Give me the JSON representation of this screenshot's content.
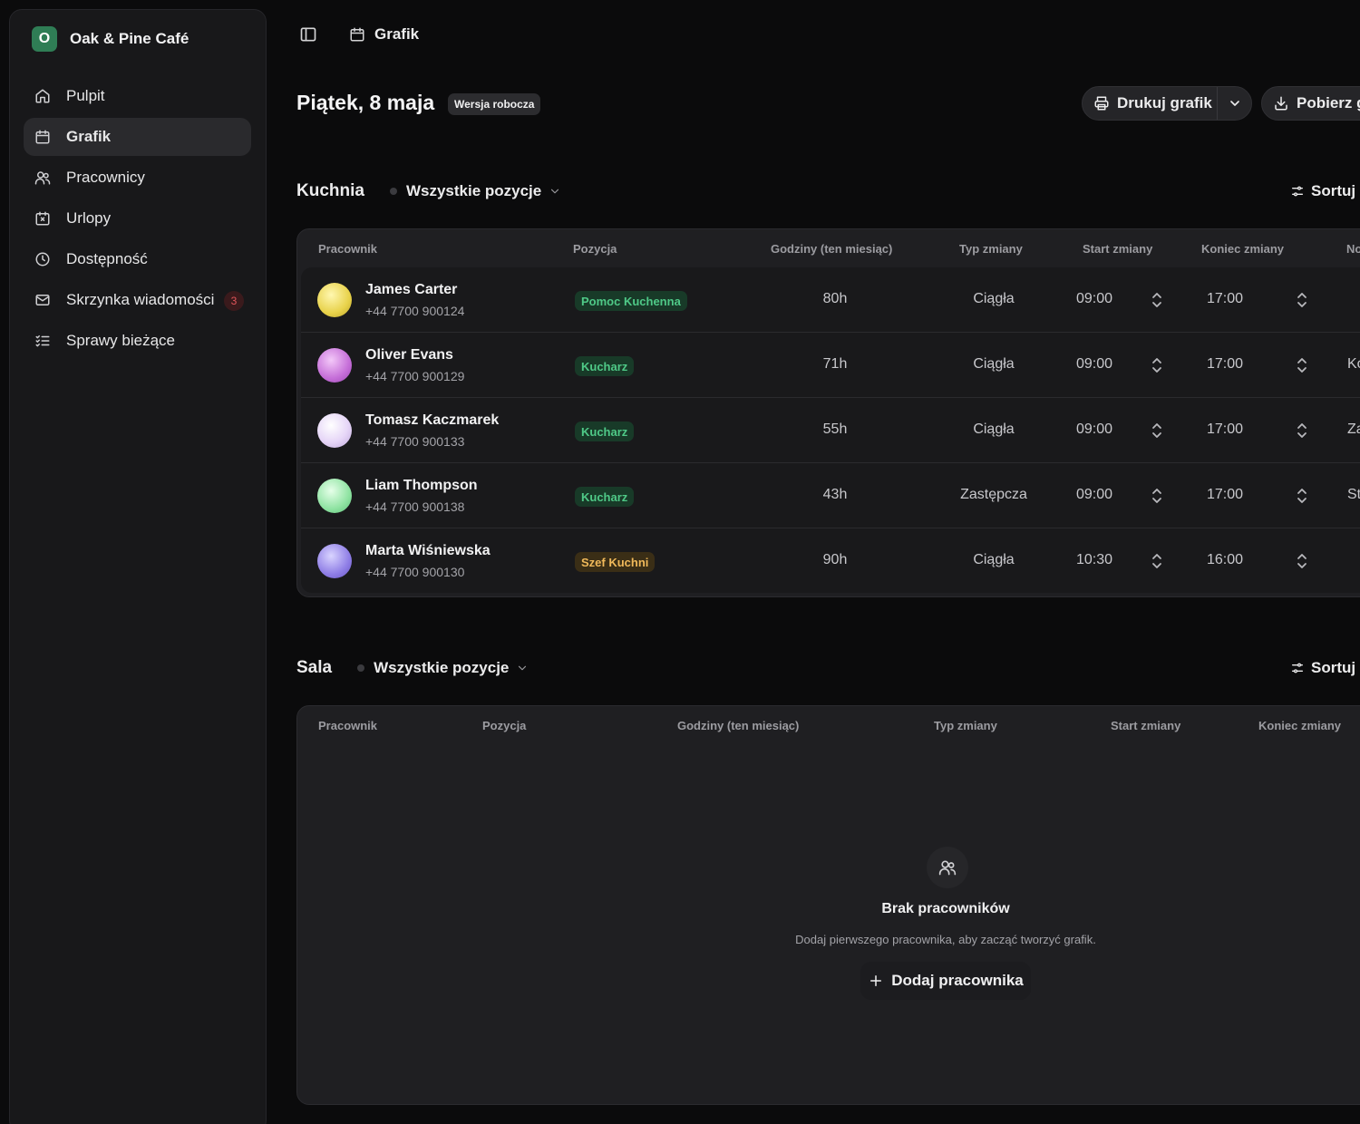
{
  "sidebar": {
    "brand_initial": "O",
    "brand_name": "Oak & Pine Café",
    "items": [
      {
        "label": "Pulpit",
        "icon": "home-icon"
      },
      {
        "label": "Grafik",
        "icon": "calendar-icon",
        "active": true
      },
      {
        "label": "Pracownicy",
        "icon": "users-icon"
      },
      {
        "label": "Urlopy",
        "icon": "calendar-x-icon"
      },
      {
        "label": "Dostępność",
        "icon": "clock-icon"
      },
      {
        "label": "Skrzynka wiadomości",
        "icon": "mail-icon",
        "badge": "3"
      },
      {
        "label": "Sprawy bieżące",
        "icon": "list-checks-icon"
      }
    ]
  },
  "topbar": {
    "breadcrumb": "Grafik"
  },
  "page": {
    "title": "Piątek, 8 maja",
    "status_badge": "Wersja robocza",
    "print_label": "Drukuj grafik",
    "download_label": "Pobierz grafik"
  },
  "kitchen": {
    "title": "Kuchnia",
    "filter_label": "Wszystkie pozycje",
    "sort_label": "Sortuj",
    "columns": [
      "Pracownik",
      "Pozycja",
      "Godziny (ten miesiąc)",
      "Typ zmiany",
      "Start zmiany",
      "Koniec zmiany",
      "Notatki"
    ],
    "rows": [
      {
        "name": "James Carter",
        "phone": "+44 7700 900124",
        "position": "Pomoc Kuchenna",
        "hours": "80h",
        "type": "Ciągła",
        "start": "09:00",
        "end": "17:00",
        "note": ""
      },
      {
        "name": "Oliver Evans",
        "phone": "+44 7700 900129",
        "position": "Kucharz",
        "hours": "71h",
        "type": "Ciągła",
        "start": "09:00",
        "end": "17:00",
        "note": "Ko"
      },
      {
        "name": "Tomasz Kaczmarek",
        "phone": "+44 7700 900133",
        "position": "Kucharz",
        "hours": "55h",
        "type": "Ciągła",
        "start": "09:00",
        "end": "17:00",
        "note": "Za"
      },
      {
        "name": "Liam Thompson",
        "phone": "+44 7700 900138",
        "position": "Kucharz",
        "hours": "43h",
        "type": "Zastępcza",
        "start": "09:00",
        "end": "17:00",
        "note": "St"
      },
      {
        "name": "Marta Wiśniewska",
        "phone": "+44 7700 900130",
        "position": "Szef Kuchni",
        "hours": "90h",
        "type": "Ciągła",
        "start": "10:30",
        "end": "16:00",
        "note": ""
      }
    ]
  },
  "hall": {
    "title": "Sala",
    "filter_label": "Wszystkie pozycje",
    "sort_label": "Sortuj",
    "columns": [
      "Pracownik",
      "Pozycja",
      "Godziny (ten miesiąc)",
      "Typ zmiany",
      "Start zmiany",
      "Koniec zmiany"
    ],
    "empty_title": "Brak pracowników",
    "empty_description": "Dodaj pierwszego pracownika, aby zacząć tworzyć grafik.",
    "add_button": "Dodaj pracownika"
  },
  "colors": {
    "brand": "#2f7d55",
    "position_green": "#4fc987",
    "position_amber": "#f0b95a",
    "badge_red": "#e0555a"
  }
}
